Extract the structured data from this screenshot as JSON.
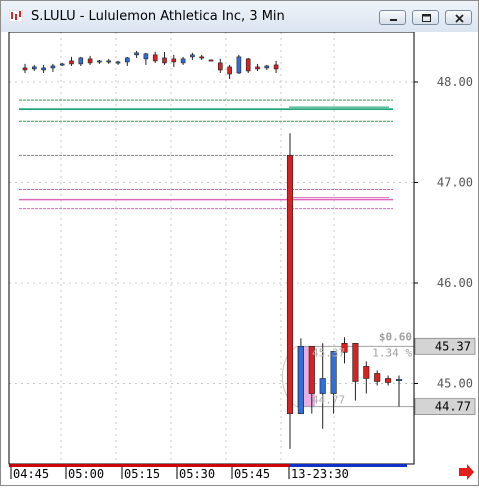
{
  "window": {
    "title": "S.LULU - Lululemon Athletica Inc, 3 Min",
    "buttons": [
      "minimize",
      "restore",
      "close"
    ]
  },
  "chart_data": {
    "type": "candlestick",
    "symbol": "S.LULU",
    "interval": "3 Min",
    "y_axis": {
      "side": "right",
      "ticks": [
        "48.00",
        "47.00",
        "46.00",
        "45.00"
      ],
      "range": [
        44.25,
        48.5
      ]
    },
    "x_axis": {
      "ticks": [
        "04:45",
        "05:00",
        "05:15",
        "05:30",
        "05:45",
        "13-23:30"
      ]
    },
    "candles_premarket": [
      {
        "o": 48.14,
        "h": 48.18,
        "l": 48.09,
        "c": 48.12
      },
      {
        "o": 48.13,
        "h": 48.17,
        "l": 48.11,
        "c": 48.15
      },
      {
        "o": 48.12,
        "h": 48.17,
        "l": 48.09,
        "c": 48.14
      },
      {
        "o": 48.14,
        "h": 48.18,
        "l": 48.1,
        "c": 48.16
      },
      {
        "o": 48.17,
        "h": 48.19,
        "l": 48.16,
        "c": 48.18
      },
      {
        "o": 48.21,
        "h": 48.25,
        "l": 48.16,
        "c": 48.18
      },
      {
        "o": 48.18,
        "h": 48.25,
        "l": 48.16,
        "c": 48.24
      },
      {
        "o": 48.23,
        "h": 48.26,
        "l": 48.17,
        "c": 48.19
      },
      {
        "o": 48.2,
        "h": 48.22,
        "l": 48.18,
        "c": 48.21
      },
      {
        "o": 48.2,
        "h": 48.23,
        "l": 48.18,
        "c": 48.21
      },
      {
        "o": 48.19,
        "h": 48.21,
        "l": 48.17,
        "c": 48.2
      },
      {
        "o": 48.2,
        "h": 48.25,
        "l": 48.16,
        "c": 48.24
      },
      {
        "o": 48.27,
        "h": 48.31,
        "l": 48.24,
        "c": 48.29
      },
      {
        "o": 48.23,
        "h": 48.29,
        "l": 48.17,
        "c": 48.28
      },
      {
        "o": 48.27,
        "h": 48.3,
        "l": 48.19,
        "c": 48.21
      },
      {
        "o": 48.24,
        "h": 48.3,
        "l": 48.17,
        "c": 48.19
      },
      {
        "o": 48.23,
        "h": 48.27,
        "l": 48.15,
        "c": 48.2
      },
      {
        "o": 48.19,
        "h": 48.25,
        "l": 48.17,
        "c": 48.23
      },
      {
        "o": 48.25,
        "h": 48.29,
        "l": 48.22,
        "c": 48.27
      },
      {
        "o": 48.25,
        "h": 48.27,
        "l": 48.22,
        "c": 48.24
      },
      {
        "o": 48.22,
        "h": 48.22,
        "l": 48.21,
        "c": 48.21
      },
      {
        "o": 48.19,
        "h": 48.23,
        "l": 48.09,
        "c": 48.12
      },
      {
        "o": 48.15,
        "h": 48.17,
        "l": 48.03,
        "c": 48.08
      },
      {
        "o": 48.09,
        "h": 48.27,
        "l": 48.08,
        "c": 48.25
      },
      {
        "o": 48.23,
        "h": 48.24,
        "l": 48.09,
        "c": 48.11
      },
      {
        "o": 48.15,
        "h": 48.18,
        "l": 48.11,
        "c": 48.13
      },
      {
        "o": 48.14,
        "h": 48.17,
        "l": 48.12,
        "c": 48.16
      },
      {
        "o": 48.17,
        "h": 48.21,
        "l": 48.09,
        "c": 48.13
      }
    ],
    "candles_open": [
      {
        "o": 47.27,
        "h": 47.49,
        "l": 44.35,
        "c": 44.7
      },
      {
        "o": 44.7,
        "h": 45.45,
        "l": 44.7,
        "c": 45.37
      },
      {
        "o": 45.37,
        "h": 45.37,
        "l": 44.7,
        "c": 44.9
      },
      {
        "o": 44.9,
        "h": 45.4,
        "l": 44.55,
        "c": 45.05
      },
      {
        "o": 44.9,
        "h": 45.3,
        "l": 44.7,
        "c": 45.32
      },
      {
        "o": 45.4,
        "h": 45.46,
        "l": 45.2,
        "c": 45.31
      },
      {
        "o": 45.4,
        "h": 45.4,
        "l": 44.83,
        "c": 45.02
      },
      {
        "o": 45.17,
        "h": 45.22,
        "l": 44.9,
        "c": 45.05
      },
      {
        "o": 45.1,
        "h": 45.13,
        "l": 44.98,
        "c": 45.02
      },
      {
        "o": 45.05,
        "h": 45.08,
        "l": 44.98,
        "c": 45.01
      },
      {
        "o": 45.03,
        "h": 45.08,
        "l": 44.77,
        "c": 45.04
      }
    ],
    "horizontal_lines": [
      {
        "price": 47.82,
        "color": "#22aa44",
        "style": "dashed"
      },
      {
        "price": 47.73,
        "color": "#009966",
        "style": "solid"
      },
      {
        "price": 47.61,
        "color": "#22aa44",
        "style": "dashed"
      },
      {
        "price": 47.27,
        "color": "#888888",
        "style": "dashed"
      },
      {
        "price": 46.93,
        "color": "#dd66bb",
        "style": "dashed"
      },
      {
        "price": 46.83,
        "color": "#dd66bb",
        "style": "solid"
      },
      {
        "price": 46.74,
        "color": "#dd66bb",
        "style": "dashed"
      }
    ],
    "measure": {
      "high": "45.37",
      "low": "44.77",
      "delta": "$0.60",
      "pct": "1.34 %",
      "high_value": 45.37,
      "low_value": 44.77
    },
    "price_labels": [
      "45.37",
      "44.77"
    ],
    "colors": {
      "up": "#2f6fdc",
      "down": "#d92121",
      "grid": "#c8c8c8",
      "session_bar_red": "#cc0000",
      "session_bar_blue": "#1030c8",
      "scroll_arrow": "#e31c1c"
    }
  }
}
